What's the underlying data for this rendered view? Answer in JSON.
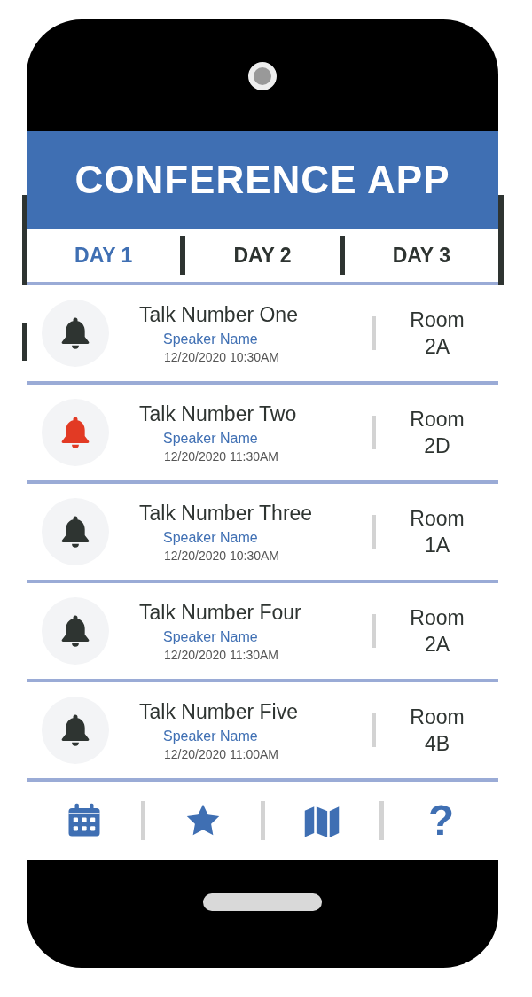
{
  "app": {
    "title": "CONFERENCE APP"
  },
  "tabs": [
    {
      "label": "DAY 1",
      "selected": true
    },
    {
      "label": "DAY 2",
      "selected": false
    },
    {
      "label": "DAY 3",
      "selected": false
    }
  ],
  "talks": [
    {
      "title": "Talk Number One",
      "speaker": "Speaker Name",
      "time": "12/20/2020 10:30AM",
      "room": "Room\n2A",
      "reminder": false
    },
    {
      "title": "Talk Number Two",
      "speaker": "Speaker Name",
      "time": "12/20/2020 11:30AM",
      "room": "Room\n2D",
      "reminder": true
    },
    {
      "title": "Talk Number Three",
      "speaker": "Speaker Name",
      "time": "12/20/2020 10:30AM",
      "room": "Room\n1A",
      "reminder": false
    },
    {
      "title": "Talk Number Four",
      "speaker": "Speaker Name",
      "time": "12/20/2020 11:30AM",
      "room": "Room\n2A",
      "reminder": false
    },
    {
      "title": "Talk Number Five",
      "speaker": "Speaker Name",
      "time": "12/20/2020 11:00AM",
      "room": "Room\n4B",
      "reminder": false
    }
  ],
  "nav": [
    {
      "kind": "calendar"
    },
    {
      "kind": "star"
    },
    {
      "kind": "map"
    },
    {
      "kind": "help",
      "glyph": "?"
    }
  ]
}
